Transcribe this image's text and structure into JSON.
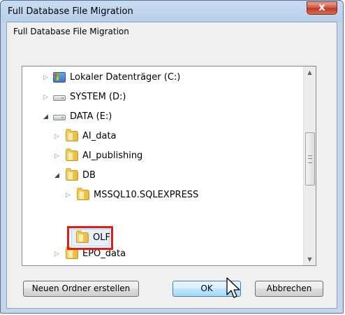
{
  "window": {
    "title": "Full Database File Migration",
    "close_symbol": "x"
  },
  "dialog": {
    "description": "Full Database File Migration"
  },
  "tree": {
    "items": [
      {
        "label": "Lokaler Datenträger (C:)",
        "icon": "system-drive-icon",
        "expanded": false
      },
      {
        "label": "SYSTEM (D:)",
        "icon": "drive-icon",
        "expanded": false
      },
      {
        "label": "DATA (E:)",
        "icon": "drive-icon",
        "expanded": true
      },
      {
        "label": "AI_data",
        "icon": "folder-icon",
        "expanded": false
      },
      {
        "label": "AI_publishing",
        "icon": "folder-icon",
        "expanded": false
      },
      {
        "label": "DB",
        "icon": "folder-icon",
        "expanded": true
      },
      {
        "label": "MSSQL10.SQLEXPRESS",
        "icon": "folder-icon",
        "expanded": false
      },
      {
        "label": "OLF",
        "icon": "folder-icon",
        "selected": true
      },
      {
        "label": "EPO_data",
        "icon": "folder-icon",
        "expanded": false
      }
    ]
  },
  "buttons": {
    "new_folder": "Neuen Ordner erstellen",
    "ok": "OK",
    "cancel": "Abbrechen"
  },
  "colors": {
    "highlight_border": "#e31b1b",
    "titlebar": "#c9dcf1",
    "close_button": "#c13521"
  }
}
